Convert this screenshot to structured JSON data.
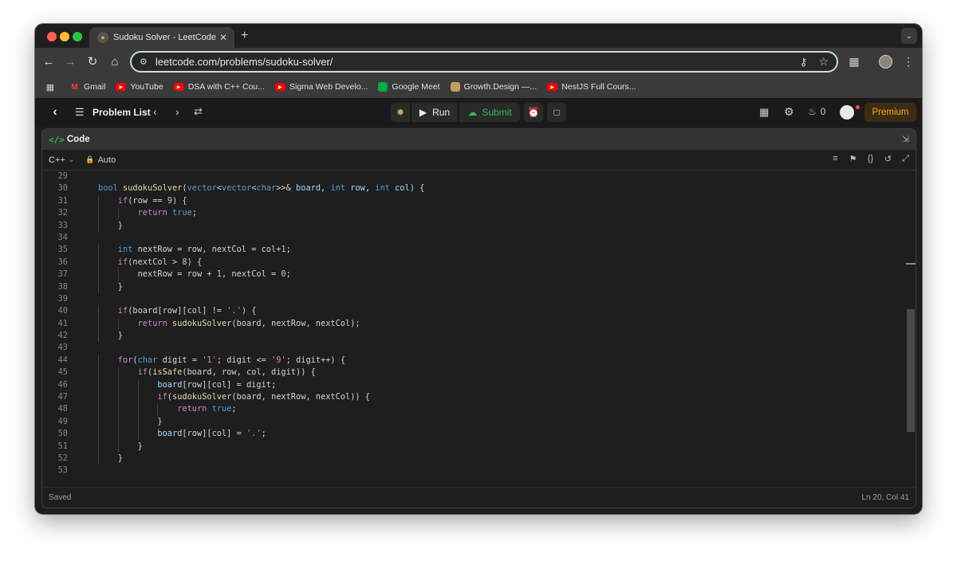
{
  "browser": {
    "tab_title": "Sudoku Solver - LeetCode",
    "url": "leetcode.com/problems/sudoku-solver/",
    "bookmarks": [
      {
        "label": "Gmail",
        "icon": "gmail-icon"
      },
      {
        "label": "YouTube",
        "icon": "youtube-icon"
      },
      {
        "label": "DSA with C++ Cou...",
        "icon": "youtube-icon"
      },
      {
        "label": "Sigma Web Develo...",
        "icon": "youtube-icon"
      },
      {
        "label": "Google Meet",
        "icon": "meet-icon"
      },
      {
        "label": "Growth.Design —...",
        "icon": "growth-design-icon"
      },
      {
        "label": "NestJS Full Cours...",
        "icon": "youtube-icon"
      }
    ]
  },
  "leetcode": {
    "problem_list": "Problem List",
    "run": "Run",
    "submit": "Submit",
    "streak": "0",
    "premium": "Premium"
  },
  "editor": {
    "panel_title": "Code",
    "language": "C++",
    "mode": "Auto",
    "status_saved": "Saved",
    "cursor_position": "Ln 20, Col 41"
  },
  "colors": {
    "accent_green": "#2cbb5d",
    "premium_orange": "#ffa116",
    "editor_bg": "#1e1e1e"
  },
  "code_lines": [
    {
      "n": "29",
      "indent": 0,
      "tokens": []
    },
    {
      "n": "30",
      "indent": 1,
      "tokens": [
        [
          "kw",
          "bool "
        ],
        [
          "fn",
          "sudokuSolver"
        ],
        [
          "plain",
          "("
        ],
        [
          "kw",
          "vector"
        ],
        [
          "plain",
          "<"
        ],
        [
          "kw",
          "vector"
        ],
        [
          "plain",
          "<"
        ],
        [
          "kw",
          "char"
        ],
        [
          "plain",
          ">>& "
        ],
        [
          "var",
          "board"
        ],
        [
          "plain",
          ", "
        ],
        [
          "kw",
          "int "
        ],
        [
          "var",
          "row"
        ],
        [
          "plain",
          ", "
        ],
        [
          "kw",
          "int "
        ],
        [
          "var",
          "col"
        ],
        [
          "plain",
          ") {"
        ]
      ]
    },
    {
      "n": "31",
      "indent": 2,
      "tokens": [
        [
          "ctl",
          "if"
        ],
        [
          "plain",
          "(row == "
        ],
        [
          "num",
          "9"
        ],
        [
          "plain",
          ") {"
        ]
      ]
    },
    {
      "n": "32",
      "indent": 3,
      "tokens": [
        [
          "ctl",
          "return "
        ],
        [
          "kw",
          "true"
        ],
        [
          "plain",
          ";"
        ]
      ]
    },
    {
      "n": "33",
      "indent": 2,
      "tokens": [
        [
          "plain",
          "}"
        ]
      ]
    },
    {
      "n": "34",
      "indent": 0,
      "tokens": []
    },
    {
      "n": "35",
      "indent": 2,
      "tokens": [
        [
          "kw",
          "int "
        ],
        [
          "plain",
          "nextRow = row, nextCol = col+"
        ],
        [
          "num",
          "1"
        ],
        [
          "plain",
          ";"
        ]
      ]
    },
    {
      "n": "36",
      "indent": 2,
      "tokens": [
        [
          "ctl",
          "if"
        ],
        [
          "plain",
          "(nextCol > "
        ],
        [
          "num",
          "8"
        ],
        [
          "plain",
          ") {"
        ]
      ]
    },
    {
      "n": "37",
      "indent": 3,
      "tokens": [
        [
          "plain",
          "nextRow = row + "
        ],
        [
          "num",
          "1"
        ],
        [
          "plain",
          ", nextCol = "
        ],
        [
          "num",
          "0"
        ],
        [
          "plain",
          ";"
        ]
      ]
    },
    {
      "n": "38",
      "indent": 2,
      "tokens": [
        [
          "plain",
          "}"
        ]
      ]
    },
    {
      "n": "39",
      "indent": 0,
      "tokens": []
    },
    {
      "n": "40",
      "indent": 2,
      "tokens": [
        [
          "ctl",
          "if"
        ],
        [
          "plain",
          "(board[row][col] != "
        ],
        [
          "str",
          "'.'"
        ],
        [
          "plain",
          ") {"
        ]
      ]
    },
    {
      "n": "41",
      "indent": 3,
      "tokens": [
        [
          "ctl",
          "return "
        ],
        [
          "fn",
          "sudokuSolver"
        ],
        [
          "plain",
          "(board, nextRow, nextCol);"
        ]
      ]
    },
    {
      "n": "42",
      "indent": 2,
      "tokens": [
        [
          "plain",
          "}"
        ]
      ]
    },
    {
      "n": "43",
      "indent": 0,
      "tokens": []
    },
    {
      "n": "44",
      "indent": 2,
      "tokens": [
        [
          "ctl",
          "for"
        ],
        [
          "plain",
          "("
        ],
        [
          "kw",
          "char "
        ],
        [
          "plain",
          "digit = "
        ],
        [
          "str",
          "'1'"
        ],
        [
          "plain",
          "; digit <= "
        ],
        [
          "str",
          "'9'"
        ],
        [
          "plain",
          "; digit++) {"
        ]
      ]
    },
    {
      "n": "45",
      "indent": 3,
      "tokens": [
        [
          "ctl",
          "if"
        ],
        [
          "plain",
          "("
        ],
        [
          "fn",
          "isSafe"
        ],
        [
          "plain",
          "(board, row, col, digit)) {"
        ]
      ]
    },
    {
      "n": "46",
      "indent": 4,
      "tokens": [
        [
          "var",
          "board"
        ],
        [
          "plain",
          "[row][col] = digit;"
        ]
      ]
    },
    {
      "n": "47",
      "indent": 4,
      "tokens": [
        [
          "ctl",
          "if"
        ],
        [
          "plain",
          "("
        ],
        [
          "fn",
          "sudokuSolver"
        ],
        [
          "plain",
          "(board, nextRow, nextCol)) {"
        ]
      ]
    },
    {
      "n": "48",
      "indent": 5,
      "tokens": [
        [
          "ctl",
          "return "
        ],
        [
          "kw",
          "true"
        ],
        [
          "plain",
          ";"
        ]
      ]
    },
    {
      "n": "49",
      "indent": 4,
      "tokens": [
        [
          "plain",
          "}"
        ]
      ]
    },
    {
      "n": "50",
      "indent": 4,
      "tokens": [
        [
          "var",
          "board"
        ],
        [
          "plain",
          "[row][col] = "
        ],
        [
          "str",
          "'.'"
        ],
        [
          "plain",
          ";"
        ]
      ]
    },
    {
      "n": "51",
      "indent": 3,
      "tokens": [
        [
          "plain",
          "}"
        ]
      ]
    },
    {
      "n": "52",
      "indent": 2,
      "tokens": [
        [
          "plain",
          "}"
        ]
      ]
    },
    {
      "n": "53",
      "indent": 0,
      "tokens": []
    }
  ]
}
